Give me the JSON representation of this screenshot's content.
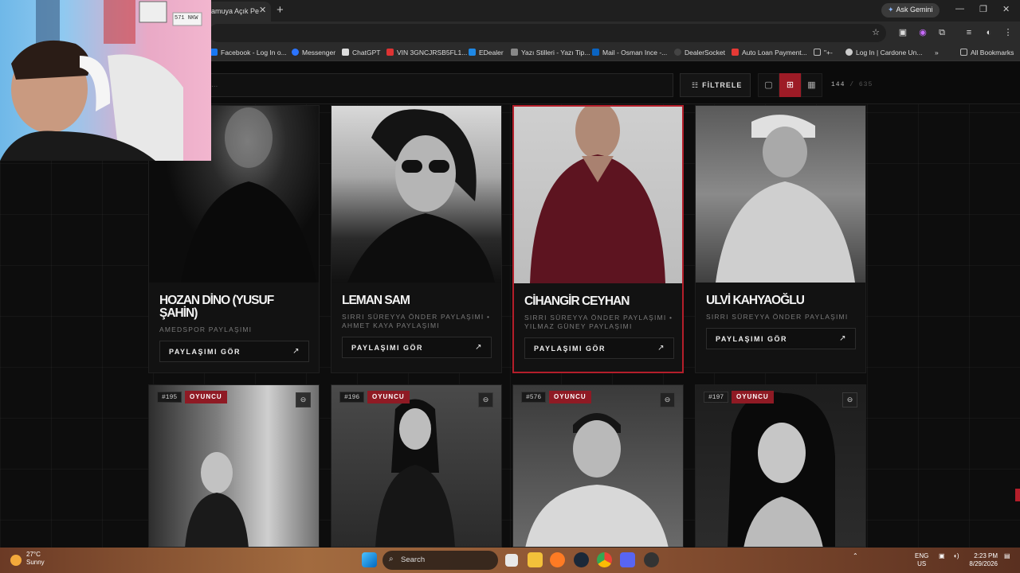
{
  "browser": {
    "tab_title": "amuya Açık Pe",
    "new_tab": "+",
    "gemini_label": "Ask Gemini",
    "bookmarks": [
      {
        "label": "Facebook - Log In o...",
        "color": "#1877f2"
      },
      {
        "label": "Messenger",
        "color": "#2b74ff"
      },
      {
        "label": "ChatGPT",
        "color": "#dddddd"
      },
      {
        "label": "VIN 3GNCJRSB5FL1...",
        "color": "#d33"
      },
      {
        "label": "EDealer",
        "color": "#1e88e5"
      },
      {
        "label": "Yazı Stilleri - Yazı Tip...",
        "color": "#888888"
      },
      {
        "label": "Mail - Osman Ince -...",
        "color": "#0a64c2"
      },
      {
        "label": "DealerSocket",
        "color": "#444444"
      },
      {
        "label": "Auto Loan Payment...",
        "color": "#e53935"
      },
      {
        "label": "\"+-",
        "color": "#bbbbbb"
      },
      {
        "label": "Log In | Cardone Un...",
        "color": "#cccccc"
      }
    ],
    "all_bookmarks": "All Bookmarks",
    "more_bookmarks": "»"
  },
  "webcam": {
    "sign": "571 NKW"
  },
  "toolbar": {
    "search_placeholder": "...",
    "filter_icon": "☷",
    "filter_label": "FİLTRELE",
    "view_single_icon": "▢",
    "view_grid_icon": "⊞",
    "view_dense_icon": "▦",
    "count_shown": "144",
    "count_sep": "/",
    "count_total": "635"
  },
  "cards_top": [
    {
      "name": "HOZAN DİNO (YUSUF ŞAHİN)",
      "sub": "AMEDSPOR PAYLAŞIMI",
      "button": "PAYLAŞIMI GÖR",
      "arrow": "↗"
    },
    {
      "name": "LEMAN SAM",
      "sub": "SIRRI SÜREYYA ÖNDER PAYLAŞIMI • AHMET KAYA PAYLAŞIMI",
      "button": "PAYLAŞIMI GÖR",
      "arrow": "↗"
    },
    {
      "name": "CİHANGİR CEYHAN",
      "sub": "SIRRI SÜREYYA ÖNDER PAYLAŞIMI • YILMAZ GÜNEY PAYLAŞIMI",
      "button": "PAYLAŞIMI GÖR",
      "arrow": "↗"
    },
    {
      "name": "ULVİ KAHYAOĞLU",
      "sub": "SIRRI SÜREYYA ÖNDER PAYLAŞIMI",
      "button": "PAYLAŞIMI GÖR",
      "arrow": "↗"
    }
  ],
  "cards_bottom": [
    {
      "id": "#195",
      "role": "OYUNCU",
      "link_icon": "⊖"
    },
    {
      "id": "#196",
      "role": "OYUNCU",
      "link_icon": "⊖"
    },
    {
      "id": "#576",
      "role": "OYUNCU",
      "link_icon": "⊖"
    },
    {
      "id": "#197",
      "role": "OYUNCU",
      "link_icon": "⊖"
    }
  ],
  "taskbar": {
    "temp": "27°C",
    "weather": "Sunny",
    "search": "Search",
    "lang1": "ENG",
    "lang2": "US",
    "time": "2:23 PM",
    "date": "8/29/2026"
  }
}
